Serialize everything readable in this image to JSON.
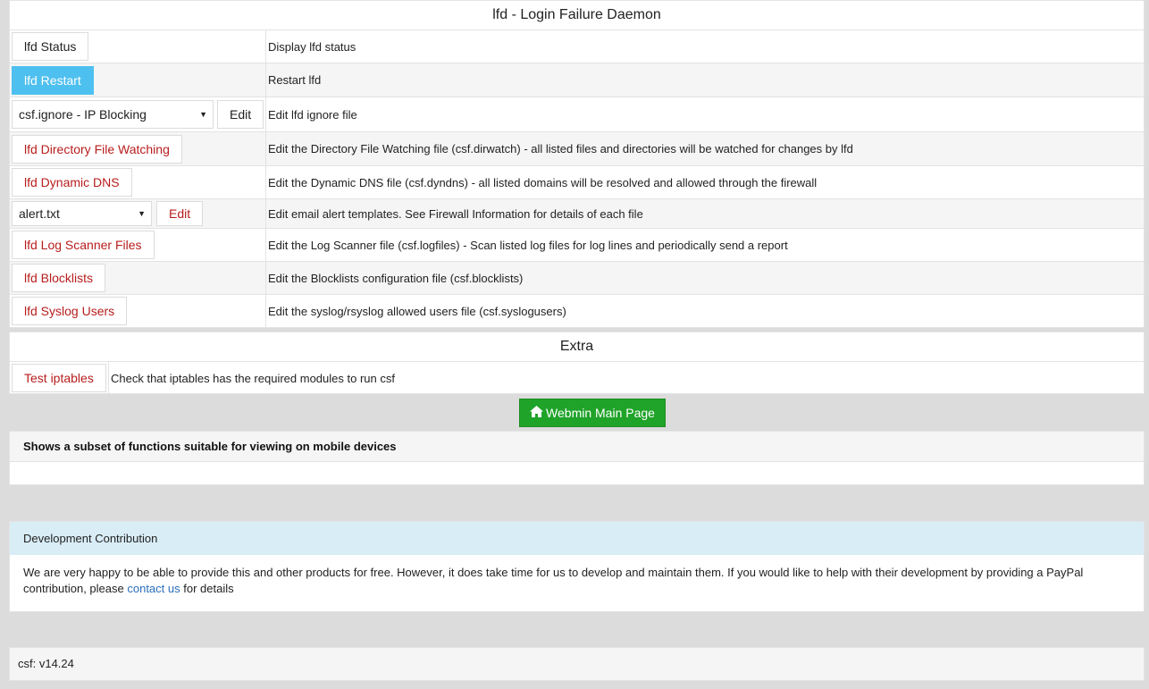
{
  "lfd": {
    "title": "lfd - Login Failure Daemon",
    "rows": [
      {
        "button": "lfd Status",
        "desc": "Display lfd status"
      },
      {
        "button": "lfd Restart",
        "desc": "Restart lfd"
      },
      {
        "select": "csf.ignore - IP Blocking",
        "button": "Edit",
        "desc": "Edit lfd ignore file"
      },
      {
        "button": "lfd Directory File Watching",
        "desc": "Edit the Directory File Watching file (csf.dirwatch) - all listed files and directories will be watched for changes by lfd"
      },
      {
        "button": "lfd Dynamic DNS",
        "desc": "Edit the Dynamic DNS file (csf.dyndns) - all listed domains will be resolved and allowed through the firewall"
      },
      {
        "select": "alert.txt",
        "button": "Edit",
        "desc": "Edit email alert templates. See Firewall Information for details of each file"
      },
      {
        "button": "lfd Log Scanner Files",
        "desc": "Edit the Log Scanner file (csf.logfiles) - Scan listed log files for log lines and periodically send a report"
      },
      {
        "button": "lfd Blocklists",
        "desc": "Edit the Blocklists configuration file (csf.blocklists)"
      },
      {
        "button": "lfd Syslog Users",
        "desc": "Edit the syslog/rsyslog allowed users file (csf.syslogusers)"
      }
    ]
  },
  "extra": {
    "title": "Extra",
    "button": "Test iptables",
    "desc": "Check that iptables has the required modules to run csf"
  },
  "webmin_button": "Webmin Main Page",
  "mobile": {
    "heading": "Shows a subset of functions suitable for viewing on mobile devices"
  },
  "dev": {
    "heading": "Development Contribution",
    "body_pre": "We are very happy to be able to provide this and other products for free. However, it does take time for us to develop and maintain them. If you would like to help with their development by providing a PayPal contribution, please ",
    "link": "contact us",
    "body_post": " for details"
  },
  "version": "csf: v14.24",
  "colors": {
    "restart_button": "#4ec0ef",
    "red_text": "#b81d1d",
    "webmin_green": "#20a329",
    "info_header": "#d9edf7"
  }
}
